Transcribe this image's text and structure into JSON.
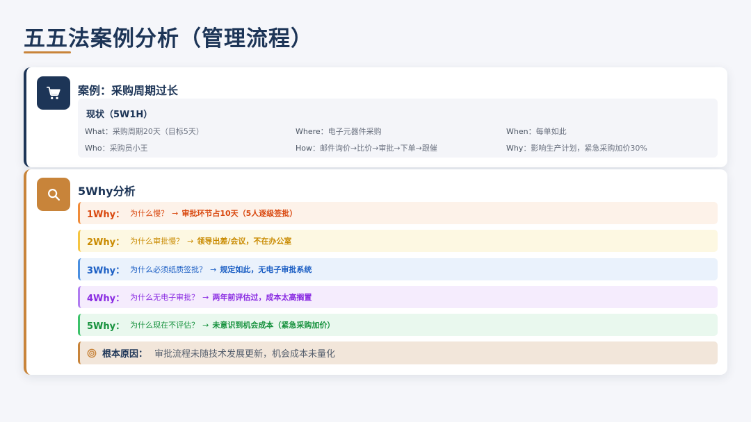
{
  "page": {
    "title": "五五法案例分析（管理流程）"
  },
  "case_card": {
    "icon": "cart-icon",
    "heading": "案例：采购周期过长",
    "status": {
      "title": "现状（5W1H）",
      "facts": [
        {
          "key": "What",
          "sep": "：",
          "value": "采购周期20天（目标5天）"
        },
        {
          "key": "Where",
          "sep": "：",
          "value": "电子元器件采购"
        },
        {
          "key": "When",
          "sep": "：",
          "value": "每单如此"
        },
        {
          "key": "Who",
          "sep": "：",
          "value": "采购员小王"
        },
        {
          "key": "How",
          "sep": "：",
          "value": "邮件询价→比价→审批→下单→跟催"
        },
        {
          "key": "Why",
          "sep": "：",
          "value": "影响生产计划，紧急采购加价30%"
        }
      ]
    }
  },
  "why_card": {
    "icon": "search-icon",
    "heading": "5Why分析",
    "whys": [
      {
        "label": "1Why：",
        "question": "为什么慢？",
        "arrow": "→",
        "answer": "审批环节占10天（5人逐级签批）",
        "color": "#d9480f",
        "bg": "#fdf2e9",
        "bar": "#f08c3a"
      },
      {
        "label": "2Why：",
        "question": "为什么审批慢？",
        "arrow": "→",
        "answer": "领导出差/会议，不在办公室",
        "color": "#c98a00",
        "bg": "#fdf8e2",
        "bar": "#f5c542"
      },
      {
        "label": "3Why：",
        "question": "为什么必须纸质签批？",
        "arrow": "→",
        "answer": "规定如此，无电子审批系统",
        "color": "#1c5fc4",
        "bg": "#eaf2fc",
        "bar": "#4a8fe0"
      },
      {
        "label": "4Why：",
        "question": "为什么无电子审批？",
        "arrow": "→",
        "answer": "两年前评估过，成本太高搁置",
        "color": "#8a2be2",
        "bg": "#f5ecfd",
        "bar": "#b07cf0"
      },
      {
        "label": "5Why：",
        "question": "为什么现在不评估？",
        "arrow": "→",
        "answer": "未意识到机会成本（紧急采购加价）",
        "color": "#16913d",
        "bg": "#e9f8ee",
        "bar": "#3cc26a"
      }
    ],
    "root": {
      "icon": "target-icon",
      "label": "根本原因：",
      "text": "审批流程未随技术发展更新，机会成本未量化"
    }
  }
}
